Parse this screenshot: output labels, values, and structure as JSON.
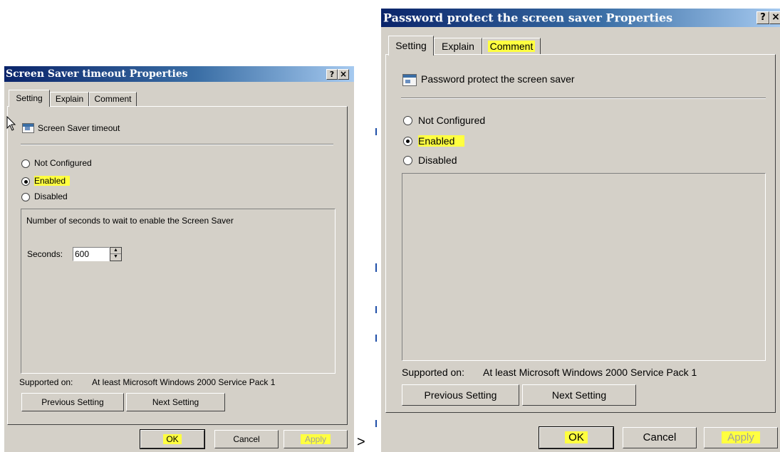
{
  "dialogs": [
    {
      "title": "Screen Saver timeout Properties",
      "help_button": "?",
      "close_button": "×",
      "tabs": [
        "Setting",
        "Explain",
        "Comment"
      ],
      "active_tab": "Setting",
      "policy_name": "Screen Saver timeout",
      "options": [
        "Not Configured",
        "Enabled",
        "Disabled"
      ],
      "selected_option": "Enabled",
      "panel_text": "Number of seconds to wait to enable the Screen Saver",
      "seconds_label": "Seconds:",
      "seconds_value": "600",
      "supported_on_label": "Supported on:",
      "supported_on_value": "At least Microsoft Windows 2000 Service Pack 1",
      "prev_button": "Previous Setting",
      "next_button": "Next Setting",
      "ok_button": "OK",
      "cancel_button": "Cancel",
      "apply_button": "Apply"
    },
    {
      "title": "Password protect the screen saver Properties",
      "help_button": "?",
      "close_button": "×",
      "tabs": [
        "Setting",
        "Explain",
        "Comment"
      ],
      "active_tab": "Setting",
      "policy_name": "Password protect the screen saver",
      "options": [
        "Not Configured",
        "Enabled",
        "Disabled"
      ],
      "selected_option": "Enabled",
      "supported_on_label": "Supported on:",
      "supported_on_value": "At least Microsoft Windows 2000 Service Pack 1",
      "prev_button": "Previous Setting",
      "next_button": "Next Setting",
      "ok_button": "OK",
      "cancel_button": "Cancel",
      "apply_button": "Apply"
    }
  ],
  "between_arrow": ">",
  "colors": {
    "dialog_bg": "#d4d0c8",
    "titlebar_start": "#0a246a",
    "titlebar_end": "#a6caf0",
    "highlight": "#ffff40"
  }
}
